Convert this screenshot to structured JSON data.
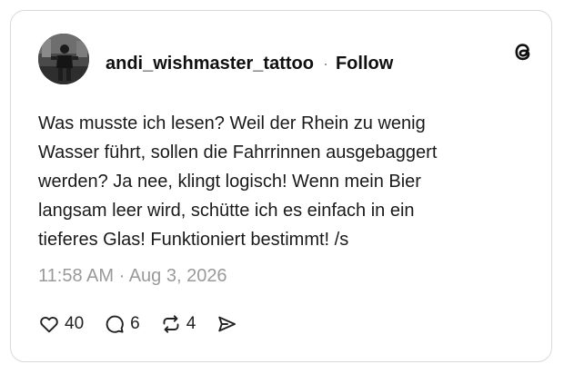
{
  "post": {
    "username": "andi_wishmaster_tattoo",
    "separator": "·",
    "follow_label": "Follow",
    "text_lines": [
      "Was musste ich lesen? Weil der Rhein zu wenig",
      "Wasser führt, sollen die Fahrrinnen ausgebaggert",
      "werden? Ja nee, klingt logisch! Wenn mein Bier",
      "langsam leer wird, schütte ich es einfach in ein",
      "tieferes Glas! Funktioniert bestimmt! /s"
    ],
    "timestamp": "11:58 AM · Aug 3, 2026"
  },
  "actions": {
    "likes": "40",
    "comments": "6",
    "reposts": "4"
  },
  "icons": {
    "brand": "threads-logo-icon",
    "like": "heart-icon",
    "comment": "comment-icon",
    "repost": "repost-icon",
    "share": "send-icon"
  }
}
